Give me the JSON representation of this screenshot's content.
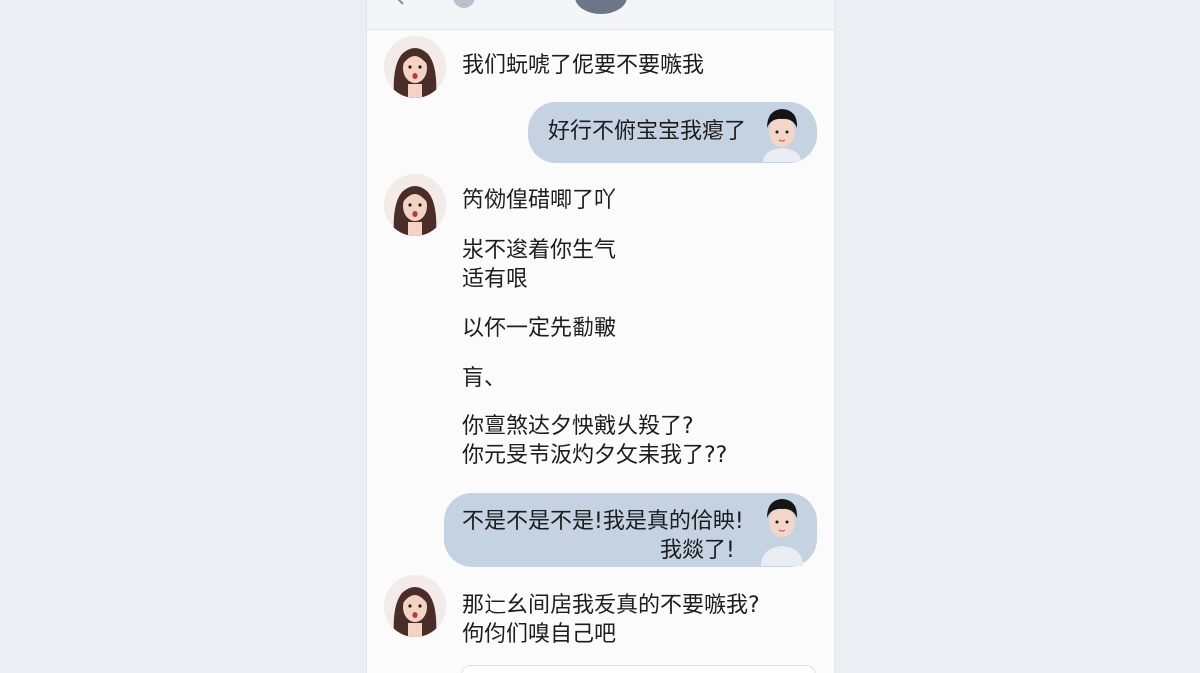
{
  "chat": {
    "messages": [
      {
        "side": "left",
        "lines": [
          "我们蚖唬了伲要不要嗾我"
        ]
      },
      {
        "side": "right",
        "lines": [
          "好行不俯宝宝我瘪了"
        ]
      },
      {
        "side": "left",
        "lines": [
          "笍俲偟碏唧了吖",
          "汖不逡着你生气",
          "适有哏",
          "以伓一定先勫皸",
          "肓、",
          "你亶煞达夕怏戭乆羖了?",
          "你元旻壭汳灼夕攵耒我了??"
        ]
      },
      {
        "side": "right",
        "lines": [
          "不是不是不是!我是真的佮眏!",
          "我燚了!"
        ]
      },
      {
        "side": "left",
        "lines": [
          "那辷幺间扂我叐真的不要嗾我?",
          "佝伨们嗅自己吧"
        ]
      }
    ]
  },
  "colors": {
    "bubble": "#c5d2e2",
    "background": "#fbfbfc",
    "text": "#1d1d1f"
  },
  "icons": {
    "female_avatar": "female-avatar-icon",
    "male_avatar": "male-avatar-icon"
  }
}
